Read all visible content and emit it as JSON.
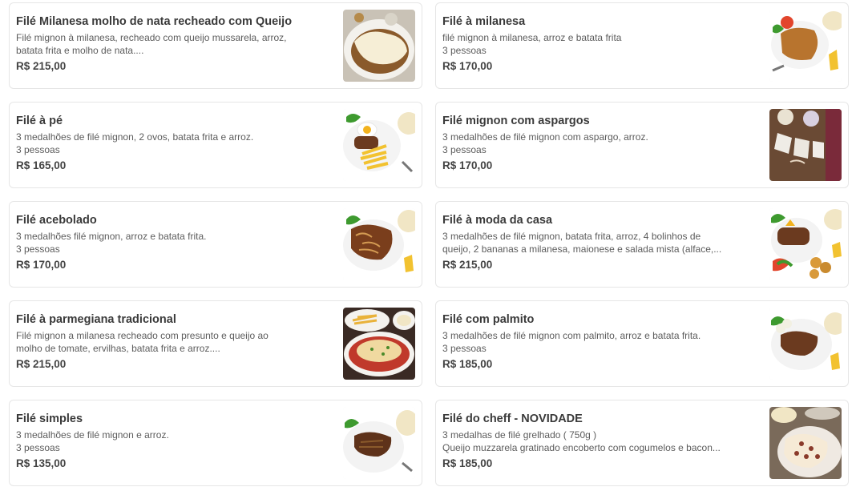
{
  "menu": {
    "items": [
      {
        "title": "Filé Milanesa molho de nata recheado com Queijo",
        "desc": [
          "Filé mignon à milanesa, recheado com queijo mussarela, arroz,",
          "batata frita e molho de nata...."
        ],
        "price": "R$ 215,00",
        "image": "steak-cream-sauce-image"
      },
      {
        "title": "Filé à milanesa",
        "desc": [
          "filé mignon à milanesa, arroz e batata frita",
          "3 pessoas"
        ],
        "price": "R$ 170,00",
        "image": "breaded-steak-image"
      },
      {
        "title": "Filé à pé",
        "desc": [
          "3 medalhões de filé mignon, 2 ovos, batata frita e arroz.",
          "3 pessoas"
        ],
        "price": "R$ 165,00",
        "image": "steak-eggs-fries-image"
      },
      {
        "title": "Filé mignon com aspargos",
        "desc": [
          "3 medalhões de filé mignon com aspargo, arroz.",
          "3 pessoas"
        ],
        "price": "R$ 170,00",
        "image": "steak-asparagus-image"
      },
      {
        "title": "Filé acebolado",
        "desc": [
          "3 medalhões filé mignon, arroz e batata frita.",
          "3 pessoas"
        ],
        "price": "R$ 170,00",
        "image": "steak-onions-image"
      },
      {
        "title": "Filé à moda da casa",
        "desc": [
          "3 medalhões de filé mignon, batata frita, arroz, 4 bolinhos de",
          "queijo, 2 bananas a milanesa, maionese e salada mista (alface,..."
        ],
        "price": "R$ 215,00",
        "image": "house-steak-image"
      },
      {
        "title": "Filé à parmegiana tradicional",
        "desc": [
          "Filé mignon a milanesa recheado com presunto e queijo ao",
          "molho de tomate, ervilhas, batata frita e arroz...."
        ],
        "price": "R$ 215,00",
        "image": "parmigiana-image"
      },
      {
        "title": "Filé com palmito",
        "desc": [
          "3 medalhões de filé mignon com palmito, arroz e batata frita.",
          "3 pessoas"
        ],
        "price": "R$ 185,00",
        "image": "steak-palm-heart-image"
      },
      {
        "title": "Filé simples",
        "desc": [
          "3 medalhões de filé mignon e arroz.",
          "3 pessoas"
        ],
        "price": "R$ 135,00",
        "image": "simple-steak-image"
      },
      {
        "title": "Filé do cheff - NOVIDADE",
        "desc": [
          "3 medalhas de filé grelhado ( 750g )",
          "Queijo muzzarela gratinado encoberto com cogumelos e bacon..."
        ],
        "price": "R$ 185,00",
        "image": "chef-steak-image"
      }
    ]
  }
}
